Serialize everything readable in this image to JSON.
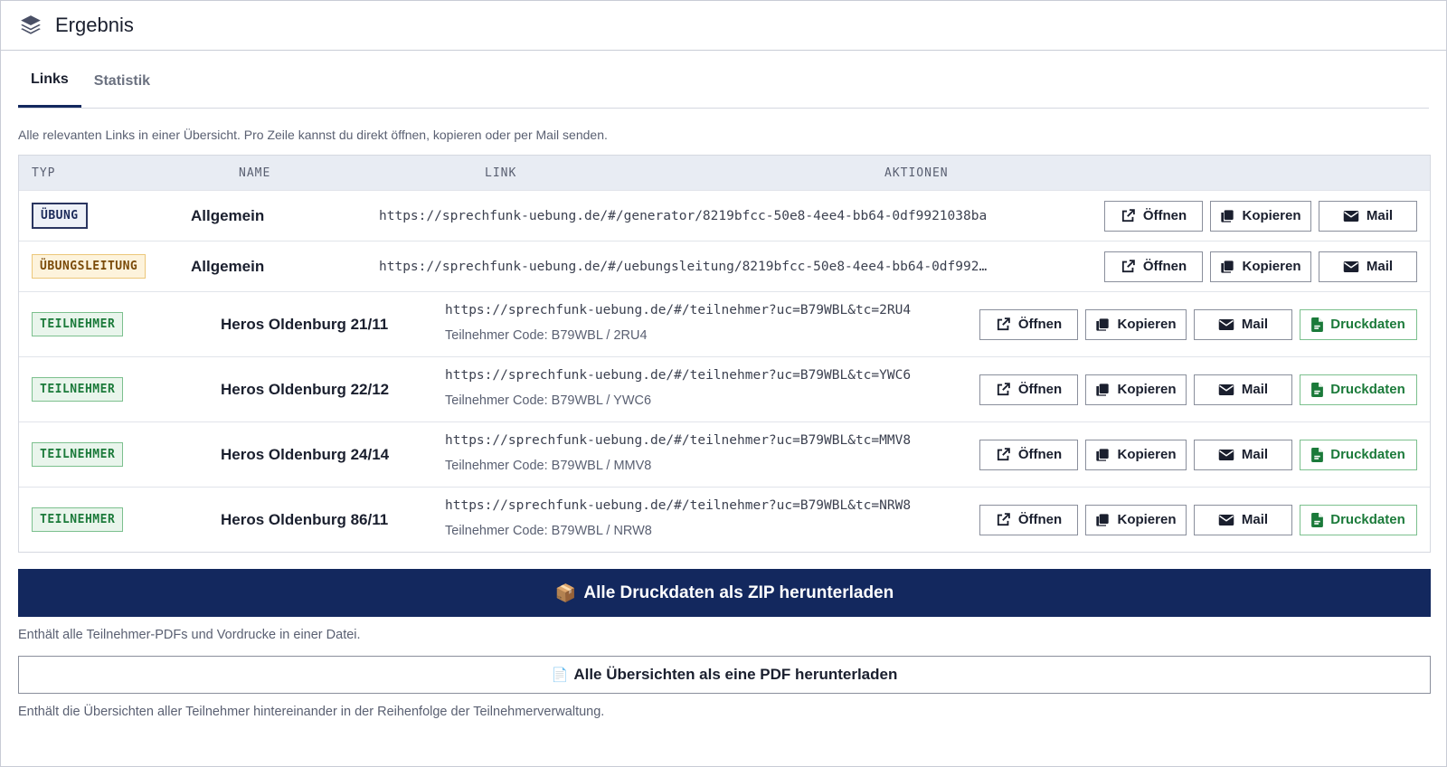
{
  "header": {
    "title": "Ergebnis",
    "icon": "layers-icon"
  },
  "tabs": [
    {
      "label": "Links",
      "active": true
    },
    {
      "label": "Statistik",
      "active": false
    }
  ],
  "description": "Alle relevanten Links in einer Übersicht. Pro Zeile kannst du direkt öffnen, kopieren oder per Mail senden.",
  "table": {
    "headers": {
      "typ": "TYP",
      "name": "NAME",
      "link": "LINK",
      "aktionen": "AKTIONEN"
    },
    "rows": [
      {
        "type": "ÜBUNG",
        "name": "Allgemein",
        "link": "https://sprechfunk-uebung.de/#/generator/8219bfcc-50e8-4ee4-bb64-0df9921038ba"
      },
      {
        "type": "ÜBUNGSLEITUNG",
        "name": "Allgemein",
        "link": "https://sprechfunk-uebung.de/#/uebungsleitung/8219bfcc-50e8-4ee4-bb64-0df992…"
      },
      {
        "type": "TEILNEHMER",
        "name": "Heros Oldenburg 21/11",
        "link": "https://sprechfunk-uebung.de/#/teilnehmer?uc=B79WBL&tc=2RU4",
        "code": "Teilnehmer Code: B79WBL / 2RU4"
      },
      {
        "type": "TEILNEHMER",
        "name": "Heros Oldenburg 22/12",
        "link": "https://sprechfunk-uebung.de/#/teilnehmer?uc=B79WBL&tc=YWC6",
        "code": "Teilnehmer Code: B79WBL / YWC6"
      },
      {
        "type": "TEILNEHMER",
        "name": "Heros Oldenburg 24/14",
        "link": "https://sprechfunk-uebung.de/#/teilnehmer?uc=B79WBL&tc=MMV8",
        "code": "Teilnehmer Code: B79WBL / MMV8"
      },
      {
        "type": "TEILNEHMER",
        "name": "Heros Oldenburg 86/11",
        "link": "https://sprechfunk-uebung.de/#/teilnehmer?uc=B79WBL&tc=NRW8",
        "code": "Teilnehmer Code: B79WBL / NRW8"
      }
    ]
  },
  "actions": {
    "open": "Öffnen",
    "copy": "Kopieren",
    "mail": "Mail",
    "druck": "Druckdaten"
  },
  "zip": {
    "label": "Alle Druckdaten als ZIP herunterladen",
    "emoji": "📦",
    "note": "Enthält alle Teilnehmer-PDFs und Vordrucke in einer Datei."
  },
  "pdf": {
    "label": "Alle Übersichten als eine PDF herunterladen",
    "emoji": "📄",
    "note": "Enthält die Übersichten aller Teilnehmer hintereinander in der Reihenfolge der Teilnehmerverwaltung."
  },
  "colors": {
    "primary": "#13285e",
    "success": "#1b7a3a",
    "warning_bg": "#fdf3dc"
  }
}
